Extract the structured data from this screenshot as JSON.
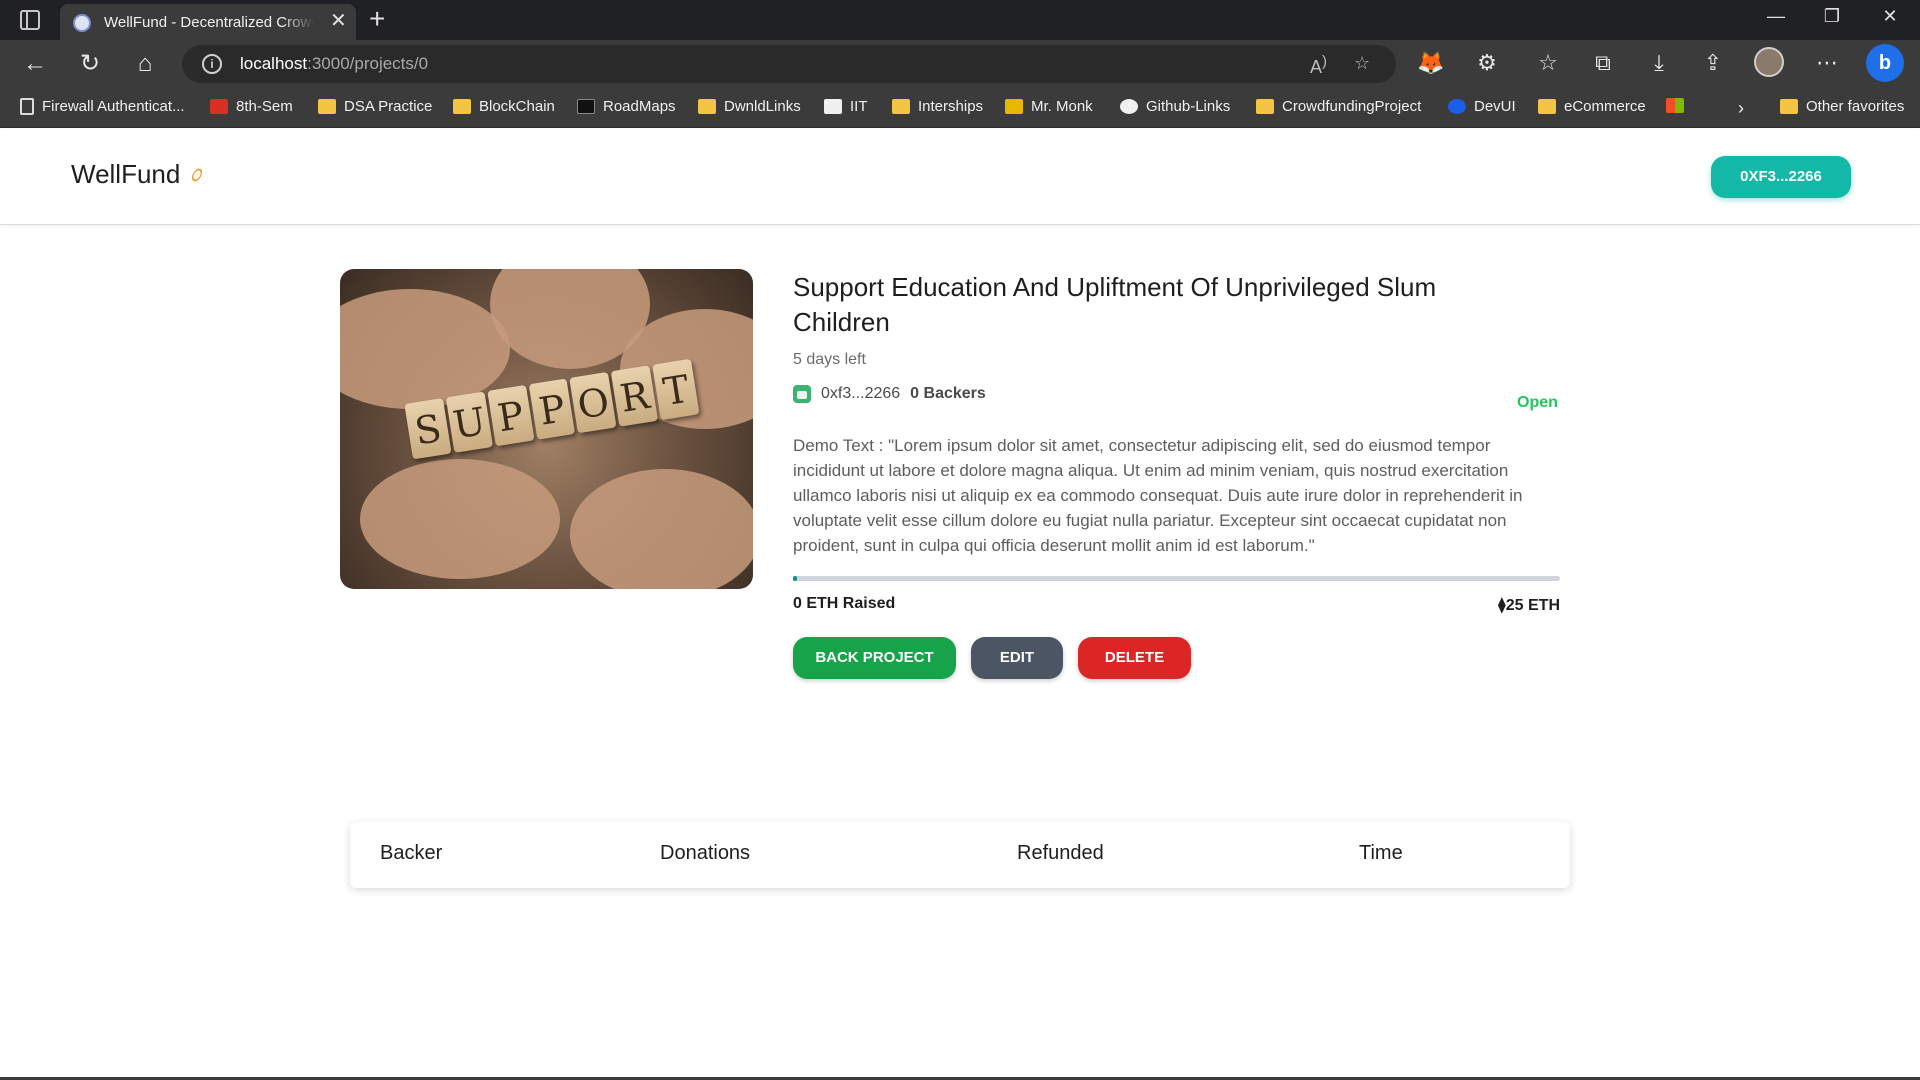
{
  "browser": {
    "tab_title": "WellFund - Decentralized Crowdfunding",
    "tab_close": "✕",
    "new_tab": "+",
    "address_host": "localhost",
    "address_path": ":3000/projects/0",
    "more_menu": "⋯",
    "bing_label": "b"
  },
  "bookmarks": [
    {
      "label": "Firewall Authenticat...",
      "icon": "page-icon"
    },
    {
      "label": "8th-Sem",
      "icon": "pdf-icon"
    },
    {
      "label": "DSA Practice",
      "icon": "folder-icon"
    },
    {
      "label": "BlockChain",
      "icon": "folder-icon"
    },
    {
      "label": "RoadMaps",
      "icon": "roadmap-icon"
    },
    {
      "label": "DwnldLinks",
      "icon": "folder-icon"
    },
    {
      "label": "IIT",
      "icon": "iit-icon"
    },
    {
      "label": "Interships",
      "icon": "folder-icon"
    },
    {
      "label": "Mr. Monk",
      "icon": "max-icon"
    },
    {
      "label": "Github-Links",
      "icon": "github-icon"
    },
    {
      "label": "CrowdfundingProject",
      "icon": "folder-icon"
    },
    {
      "label": "DevUI",
      "icon": "devui-icon"
    },
    {
      "label": "eCommerce",
      "icon": "folder-icon"
    },
    {
      "label": "",
      "icon": "microsoft-icon"
    },
    {
      "label": "Other favorites",
      "icon": "folder-icon"
    }
  ],
  "navbar": {
    "brand": "WellFund",
    "wallet_button": "0XF3...2266"
  },
  "project": {
    "image_block_letters": [
      "S",
      "U",
      "P",
      "P",
      "O",
      "R",
      "T"
    ],
    "title": "Support Education And Upliftment Of Unprivileged Slum Children",
    "days_left": "5 days left",
    "owner": "0xf3...2266",
    "backers": "0 Backers",
    "status": "Open",
    "description": "Demo Text : \"Lorem ipsum dolor sit amet, consectetur adipiscing elit, sed do eiusmod tempor incididunt ut labore et dolore magna aliqua. Ut enim ad minim veniam, quis nostrud exercitation ullamco laboris nisi ut aliquip ex ea commodo consequat. Duis aute irure dolor in reprehenderit in voluptate velit esse cillum dolore eu fugiat nulla pariatur. Excepteur sint occaecat cupidatat non proident, sunt in culpa qui officia deserunt mollit anim id est laborum.\"",
    "progress_percent": 0.5,
    "raised": "0 ETH Raised",
    "target": "25 ETH",
    "eth_symbol": "⧫"
  },
  "actions": {
    "back": "BACK PROJECT",
    "edit": "EDIT",
    "delete": "DELETE"
  },
  "table": {
    "headers": [
      "Backer",
      "Donations",
      "Refunded",
      "Time"
    ]
  },
  "colors": {
    "accent": "#14b8a6",
    "status_open": "#22c55e",
    "back_button": "#16a34a",
    "edit_button": "#4b5563",
    "delete_button": "#dc2626",
    "progress": "#0d9488"
  }
}
